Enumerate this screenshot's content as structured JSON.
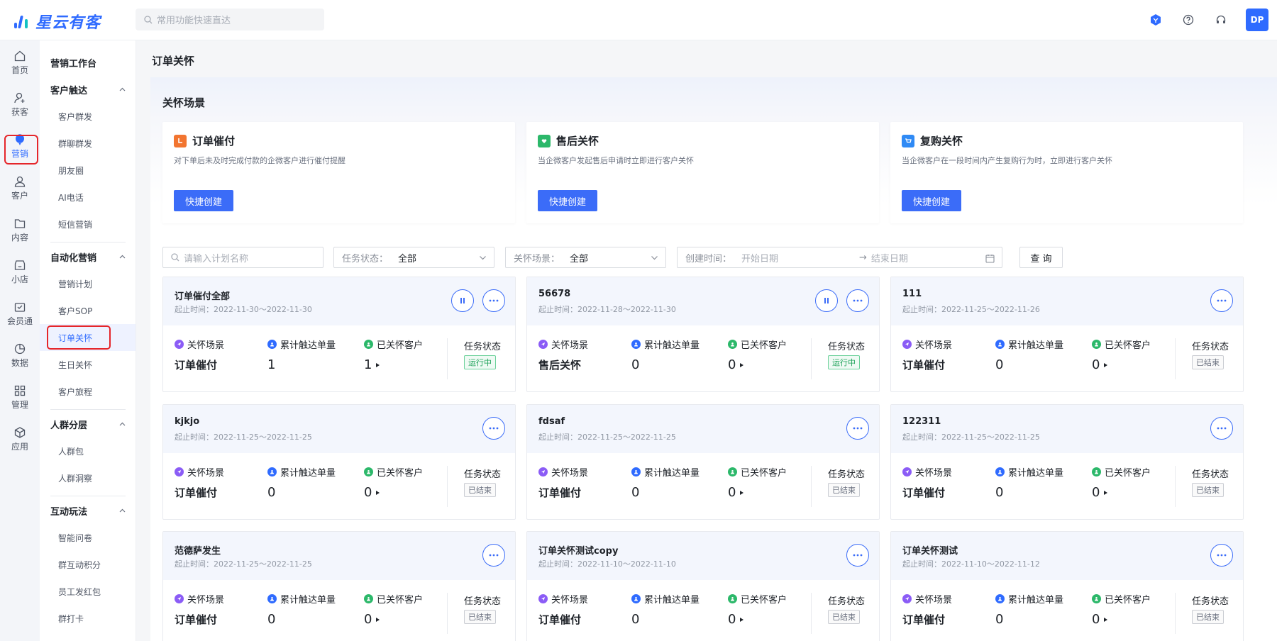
{
  "app": {
    "name": "星云有客"
  },
  "search": {
    "placeholder": "常用功能快速直达"
  },
  "topbar": {
    "avatar": "DP"
  },
  "rail": [
    {
      "label": "首页",
      "icon": "home-icon"
    },
    {
      "label": "获客",
      "icon": "user-plus-icon"
    },
    {
      "label": "营销",
      "icon": "balloon-icon",
      "active": true
    },
    {
      "label": "客户",
      "icon": "user-icon"
    },
    {
      "label": "内容",
      "icon": "folder-icon"
    },
    {
      "label": "小店",
      "icon": "shop-icon"
    },
    {
      "label": "会员通",
      "icon": "member-icon"
    },
    {
      "label": "数据",
      "icon": "pie-chart-icon"
    },
    {
      "label": "管理",
      "icon": "grid-icon"
    },
    {
      "label": "应用",
      "icon": "cube-icon"
    }
  ],
  "subnav": {
    "workbench": "营销工作台",
    "groups": [
      {
        "title": "客户触达",
        "items": [
          "客户群发",
          "群聊群发",
          "朋友圈",
          "AI电话",
          "短信营销"
        ]
      },
      {
        "title": "自动化营销",
        "items": [
          "营销计划",
          "客户SOP",
          "订单关怀",
          "生日关怀",
          "客户旅程"
        ],
        "active": "订单关怀"
      },
      {
        "title": "人群分层",
        "items": [
          "人群包",
          "人群洞察"
        ]
      },
      {
        "title": "互动玩法",
        "items": [
          "智能问卷",
          "群互动积分",
          "员工发红包",
          "群打卡"
        ]
      }
    ]
  },
  "page": {
    "title": "订单关怀",
    "section_title": "关怀场景"
  },
  "scenes": [
    {
      "title": "订单催付",
      "desc": "对下单后未及时完成付款的企微客户进行催付提醒",
      "button": "快捷创建",
      "color": "#f27530"
    },
    {
      "title": "售后关怀",
      "desc": "当企微客户发起售后申请时立即进行客户关怀",
      "button": "快捷创建",
      "color": "#2cb86a"
    },
    {
      "title": "复购关怀",
      "desc": "当企微客户在一段时间内产生复购行为时，立即进行客户关怀",
      "button": "快捷创建",
      "color": "#2f8af5"
    }
  ],
  "filters": {
    "name_placeholder": "请输入计划名称",
    "status_label": "任务状态：",
    "status_value": "全部",
    "scene_label": "关怀场景：",
    "scene_value": "全部",
    "time_label": "创建时间：",
    "start_placeholder": "开始日期",
    "arrow": "→",
    "end_placeholder": "结束日期",
    "query_button": "查 询"
  },
  "card_labels": {
    "scene": "关怀场景",
    "reach": "累计触达单量",
    "cared": "已关怀客户",
    "status": "任务状态"
  },
  "cards": [
    {
      "name": "订单催付全部",
      "date": "起止时间：2022-11-30～2022-11-30",
      "scene": "订单催付",
      "reach": "1",
      "cared": "1",
      "status": "运行中",
      "running": true
    },
    {
      "name": "56678",
      "date": "起止时间：2022-11-28～2022-11-30",
      "scene": "售后关怀",
      "reach": "0",
      "cared": "0",
      "status": "运行中",
      "running": true
    },
    {
      "name": "111",
      "date": "起止时间：2022-11-25～2022-11-26",
      "scene": "订单催付",
      "reach": "0",
      "cared": "0",
      "status": "已结束",
      "running": false
    },
    {
      "name": "kjkjo",
      "date": "起止时间：2022-11-25～2022-11-25",
      "scene": "订单催付",
      "reach": "0",
      "cared": "0",
      "status": "已结束",
      "running": false
    },
    {
      "name": "fdsaf",
      "date": "起止时间：2022-11-25～2022-11-25",
      "scene": "订单催付",
      "reach": "0",
      "cared": "0",
      "status": "已结束",
      "running": false
    },
    {
      "name": "122311",
      "date": "起止时间：2022-11-25～2022-11-25",
      "scene": "订单催付",
      "reach": "0",
      "cared": "0",
      "status": "已结束",
      "running": false
    },
    {
      "name": "范德萨发生",
      "date": "起止时间：2022-11-25～2022-11-25",
      "scene": "订单催付",
      "reach": "0",
      "cared": "0",
      "status": "已结束",
      "running": false
    },
    {
      "name": "订单关怀测试copy",
      "date": "起止时间：2022-11-10～2022-11-10",
      "scene": "订单催付",
      "reach": "0",
      "cared": "0",
      "status": "已结束",
      "running": false
    },
    {
      "name": "订单关怀测试",
      "date": "起止时间：2022-11-10～2022-11-12",
      "scene": "订单催付",
      "reach": "0",
      "cared": "0",
      "status": "已结束",
      "running": false
    }
  ]
}
